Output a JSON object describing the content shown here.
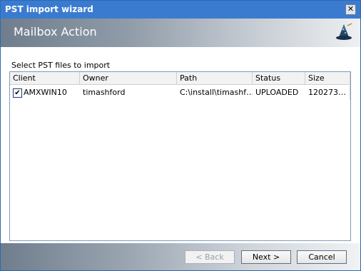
{
  "window": {
    "title": "PST import wizard",
    "close_glyph": "✕"
  },
  "banner": {
    "heading": "Mailbox Action",
    "logo_icon": "wizard-hat-icon"
  },
  "instruction": "Select PST files to import",
  "grid": {
    "columns": [
      "Client",
      "Owner",
      "Path",
      "Status",
      "Size"
    ],
    "rows": [
      {
        "checked": true,
        "client": "AMXWIN10",
        "owner": "timashford",
        "path": "C:\\install\\timashf…",
        "status": "UPLOADED",
        "size": "120273…"
      }
    ]
  },
  "buttons": {
    "back": "< Back",
    "next": "Next >",
    "cancel": "Cancel"
  }
}
